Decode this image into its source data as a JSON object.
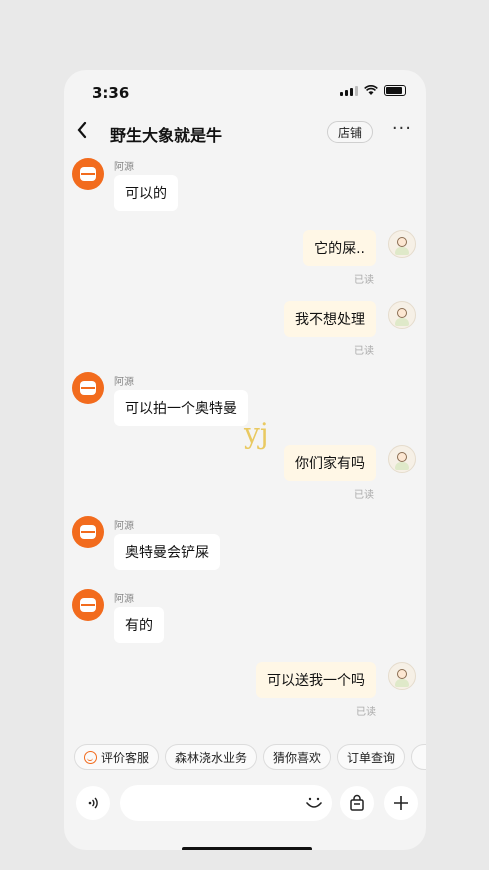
{
  "status": {
    "time": "3:36"
  },
  "nav": {
    "back_icon": "chevron-left",
    "title": "野生大象就是牛",
    "shop_label": "店铺",
    "more_icon": "ellipsis"
  },
  "messages": [
    {
      "side": "left",
      "sender": "阿源",
      "text": "可以的"
    },
    {
      "side": "right",
      "text": "它的屎..",
      "read": "已读"
    },
    {
      "side": "right",
      "text": "我不想处理",
      "read": "已读"
    },
    {
      "side": "left",
      "sender": "阿源",
      "text": "可以拍一个奥特曼"
    },
    {
      "side": "right",
      "text": "你们家有吗",
      "read": "已读"
    },
    {
      "side": "left",
      "sender": "阿源",
      "text": "奥特曼会铲屎"
    },
    {
      "side": "left",
      "sender": "阿源",
      "text": "有的"
    },
    {
      "side": "right",
      "text": "可以送我一个吗",
      "read": "已读"
    }
  ],
  "watermark": "yj",
  "quick_actions": [
    "评价客服",
    "森林浇水业务",
    "猜你喜欢",
    "订单查询"
  ],
  "input": {
    "voice_icon": "voice-waves",
    "placeholder": "",
    "emoji_icon": "smile",
    "bag_icon": "shopping-bag",
    "plus_icon": "plus"
  },
  "colors": {
    "brand": "#f26b1d",
    "right_bubble": "#fff7e6",
    "left_bubble": "#ffffff"
  }
}
